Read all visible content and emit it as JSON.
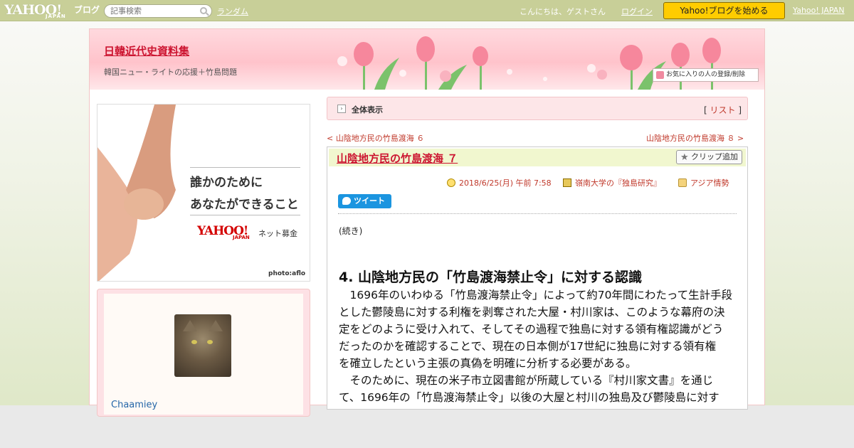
{
  "topbar": {
    "logo_text": "YAHOO!",
    "logo_sub": "JAPAN",
    "logo_blog": "ブログ",
    "search_placeholder": "記事検索",
    "random_link": "ランダム",
    "greeting": "こんにちは、ゲストさん",
    "login_link": "ログイン",
    "start_button": "Yahoo!ブログを始める",
    "yahoo_japan_link": "Yahoo! JAPAN"
  },
  "header": {
    "blog_title": "日韓近代史資料集",
    "blog_subtitle": "韓国ニュー・ライトの応援＋竹島問題",
    "favorite_button": "お気に入りの人の登録/削除"
  },
  "ad": {
    "line1": "誰かのために",
    "line2": "あなたができること",
    "brand": "YAHOO!",
    "brand_sub": "JAPAN",
    "service": "ネット募金",
    "credit": "photo:aflo"
  },
  "profile": {
    "username": "Chaamiey"
  },
  "list_bar": {
    "label": "全体表示",
    "bracket_open": "[",
    "list_link": "リスト",
    "bracket_close": "]"
  },
  "nav": {
    "prev": "< 山陰地方民の竹島渡海 ６",
    "next": "山陰地方民の竹島渡海 ８ >"
  },
  "entry": {
    "title": "山陰地方民の竹島渡海 ７",
    "clip_button": "クリップ追加",
    "date": "2018/6/25(月) 午前 7:58",
    "category": "嶺南大学の『独島研究』",
    "folder": "アジア情勢",
    "tweet_button": "ツイート",
    "continued": "(続き)",
    "heading": "4. 山陰地方民の「竹島渡海禁止令」に対する認識",
    "lines": [
      "　1696年のいわゆる「竹島渡海禁止令」によって約70年間にわたって生計手段",
      "とした鬱陵島に対する利権を剥奪された大屋・村川家は、このような幕府の決",
      "定をどのように受け入れて、そしてその過程で独島に対する領有権認識がどう",
      "だったのかを確認することで、現在の日本側が17世紀に独島に対する領有権",
      "を確立したという主張の真偽を明確に分析する必要がある。",
      "　そのために、現在の米子市立図書館が所蔵している『村川家文書』を通じ",
      "て、1696年の「竹島渡海禁止令」以後の大屋と村川の独島及び鬱陵島に対す"
    ]
  }
}
